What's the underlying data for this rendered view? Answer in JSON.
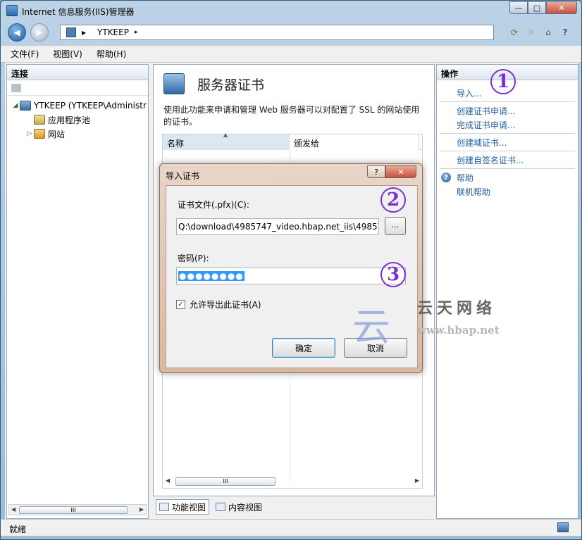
{
  "window": {
    "title": "Internet 信息服务(IIS)管理器",
    "min": "—",
    "max": "□",
    "close": "✕"
  },
  "address": {
    "path": "YTKEEP",
    "arrow1": "▸",
    "arrow2": "▸"
  },
  "menu": {
    "file": "文件(F)",
    "view": "视图(V)",
    "help": "帮助(H)"
  },
  "connections": {
    "title": "连接",
    "tree": [
      {
        "label": "YTKEEP (YTKEEP\\Administr",
        "expander": "◢"
      },
      {
        "label": "应用程序池",
        "expander": ""
      },
      {
        "label": "网站",
        "expander": "▷"
      }
    ],
    "scroll_grip": "III"
  },
  "main": {
    "heading": "服务器证书",
    "description": "使用此功能来申请和管理 Web 服务器可以对配置了 SSL 的网站使用的证书。",
    "columns": [
      "名称",
      "颁发给"
    ],
    "scroll_grip": "III"
  },
  "view_tabs": {
    "features": "功能视图",
    "content": "内容视图"
  },
  "actions": {
    "title": "操作",
    "items": [
      "导入...",
      "创建证书申请...",
      "完成证书申请...",
      "创建域证书...",
      "创建自签名证书...",
      "帮助",
      "联机帮助"
    ]
  },
  "status": {
    "text": "就绪"
  },
  "dialog": {
    "title": "导入证书",
    "help_btn": "?",
    "close_btn": "✕",
    "file_label": "证书文件(.pfx)(C):",
    "file_value": "Q:\\download\\4985747_video.hbap.net_iis\\498574",
    "browse": "...",
    "password_label": "密码(P):",
    "password_value": "●●●●●●●●",
    "allow_export": "允许导出此证书(A)",
    "check_mark": "✓",
    "ok": "确定",
    "cancel": "取消"
  },
  "annotations": {
    "one": "1",
    "two": "2",
    "three": "3"
  },
  "watermark": {
    "name": "云天网络",
    "url": "www.hbap.net"
  }
}
